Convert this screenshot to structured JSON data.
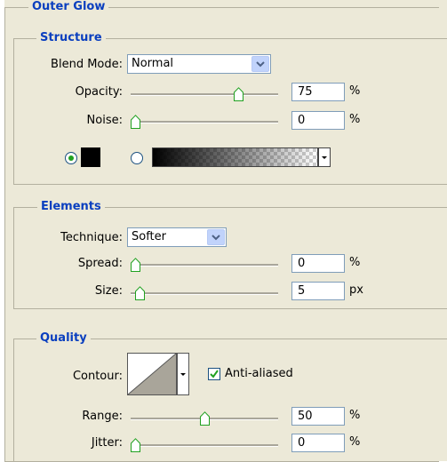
{
  "outer_glow": {
    "title": "Outer Glow"
  },
  "structure": {
    "title": "Structure",
    "blend_mode": {
      "label": "Blend Mode:",
      "value": "Normal"
    },
    "opacity": {
      "label": "Opacity:",
      "value": "75",
      "unit": "%",
      "slider_fraction": 0.75
    },
    "noise": {
      "label": "Noise:",
      "value": "0",
      "unit": "%",
      "slider_fraction": 0.0
    },
    "color_mode": "solid",
    "solid_color": "#000000"
  },
  "elements": {
    "title": "Elements",
    "technique": {
      "label": "Technique:",
      "value": "Softer"
    },
    "spread": {
      "label": "Spread:",
      "value": "0",
      "unit": "%",
      "slider_fraction": 0.0
    },
    "size": {
      "label": "Size:",
      "value": "5",
      "unit": "px",
      "slider_fraction": 0.03
    }
  },
  "quality": {
    "title": "Quality",
    "contour_label": "Contour:",
    "anti_aliased": {
      "label": "Anti-aliased",
      "checked": true
    },
    "range": {
      "label": "Range:",
      "value": "50",
      "unit": "%",
      "slider_fraction": 0.5
    },
    "jitter": {
      "label": "Jitter:",
      "value": "0",
      "unit": "%",
      "slider_fraction": 0.0
    }
  },
  "colors": {
    "heading": "#0a3fbf",
    "panel_bg": "#ECE9D8",
    "checkmark": "#21a121"
  }
}
